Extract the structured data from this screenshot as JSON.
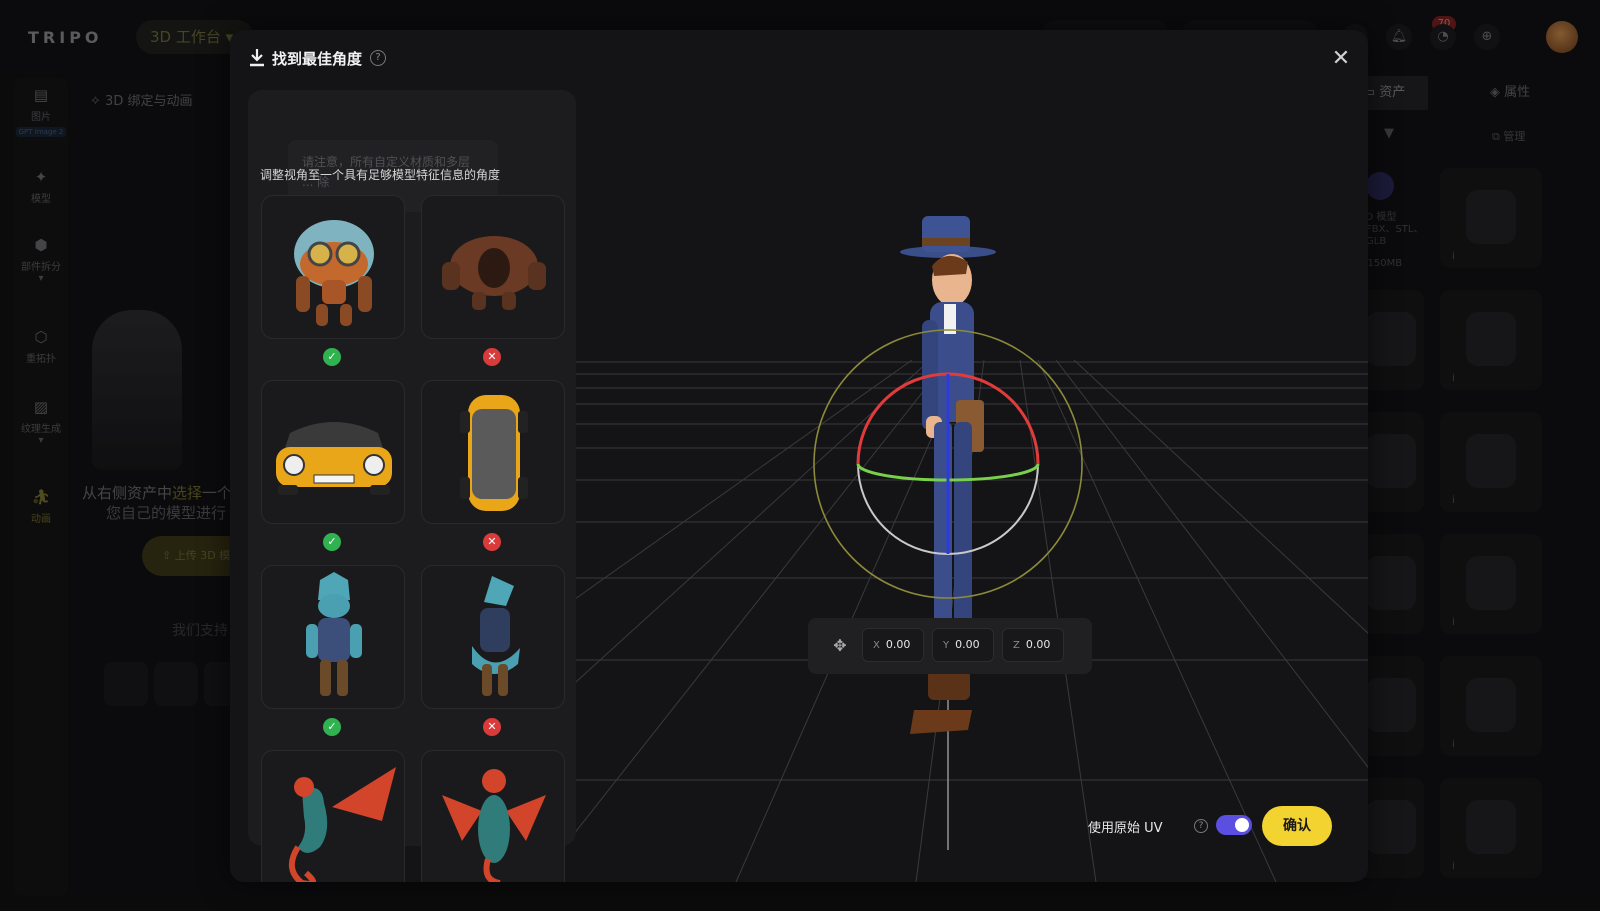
{
  "app": {
    "logo": "TRIPO",
    "workspace": "3D 工作台",
    "notification_count": "70"
  },
  "rail": {
    "items": [
      {
        "label": "图片",
        "icon": "image-icon",
        "chip": "GPT Image 2"
      },
      {
        "label": "模型",
        "icon": "sparkle-icon"
      },
      {
        "label": "部件拆分",
        "icon": "cube-icon"
      },
      {
        "label": "重拓扑",
        "icon": "polyhedron-icon"
      },
      {
        "label": "纹理生成",
        "icon": "texture-icon"
      },
      {
        "label": "动画",
        "icon": "running-figure-icon"
      }
    ]
  },
  "left_panel": {
    "title": "3D 绑定与动画",
    "prompt_line1_a": "从右侧资产中",
    "prompt_line1_hl": "选择",
    "prompt_line1_b": "一个",
    "prompt_line2": "您自己的模型进行",
    "upload_label": "上传 3D 模",
    "support_label": "我们支持"
  },
  "right_panel": {
    "tab_assets": "资产",
    "tab_properties": "属性",
    "manage_label": "管理",
    "upload_title": "传 3D 模型",
    "upload_formats": "FBX、STL、GLB",
    "upload_size": "小 ≤150MB"
  },
  "modal": {
    "title": "找到最佳角度",
    "tooltip_ghost": "请注意，所有自定义材质和多层 ... 除",
    "guide_desc": "调整视角至一个具有足够模型特征信息的角度",
    "examples": [
      {
        "subject": "robot",
        "good": "front",
        "bad": "back"
      },
      {
        "subject": "car",
        "good": "front",
        "bad": "top"
      },
      {
        "subject": "creature",
        "good": "front",
        "bad": "side"
      },
      {
        "subject": "dragon",
        "good": "side",
        "bad": "front"
      }
    ],
    "gizmo": {
      "x_label": "X",
      "x_value": "0.00",
      "y_label": "Y",
      "y_value": "0.00",
      "z_label": "Z",
      "z_value": "0.00"
    },
    "uv_label": "使用原始 UV",
    "uv_enabled": true,
    "confirm_label": "确认"
  },
  "colors": {
    "accent": "#f2d330",
    "toggle": "#5a4fe0",
    "ok": "#2fb24f",
    "bad": "#d93a3a"
  }
}
